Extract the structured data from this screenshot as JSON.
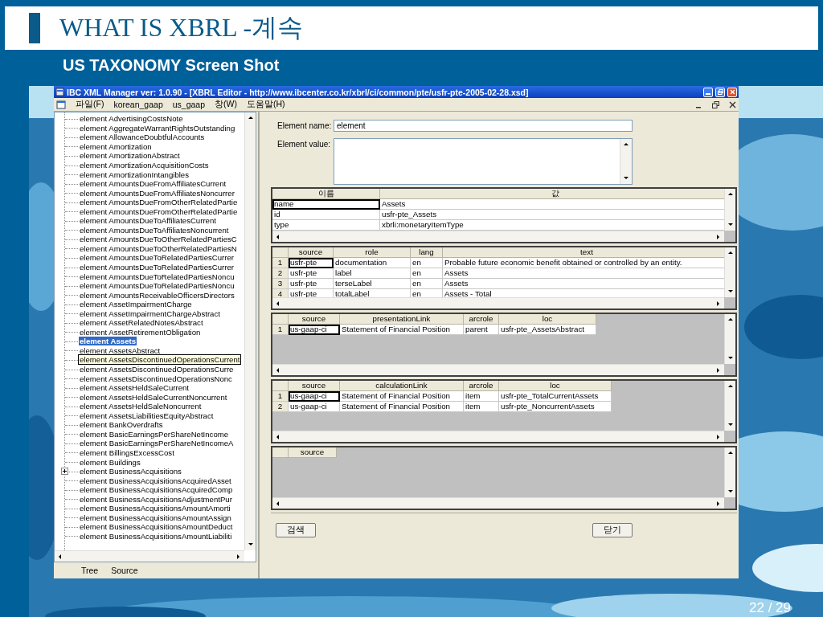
{
  "slide": {
    "title": "WHAT IS XBRL -계속",
    "subtitle": "US TAXONOMY Screen Shot",
    "page_number": "22 / 29"
  },
  "window": {
    "title": "IBC XML Manager ver: 1.0.90 - [XBRL Editor - http://www.ibcenter.co.kr/xbrl/ci/common/pte/usfr-pte-2005-02-28.xsd]"
  },
  "menu": [
    "파일(F)",
    "korean_gaap",
    "us_gaap",
    "창(W)",
    "도움말(H)"
  ],
  "tree": {
    "items": [
      {
        "label": "element AdvertisingCostsNote",
        "kind": "leaf",
        "selected": false,
        "hovered": false
      },
      {
        "label": "element AggregateWarrantRightsOutstanding",
        "kind": "leaf",
        "selected": false,
        "hovered": false
      },
      {
        "label": "element AllowanceDoubtfulAccounts",
        "kind": "leaf",
        "selected": false,
        "hovered": false
      },
      {
        "label": "element Amortization",
        "kind": "leaf",
        "selected": false,
        "hovered": false
      },
      {
        "label": "element AmortizationAbstract",
        "kind": "leaf",
        "selected": false,
        "hovered": false
      },
      {
        "label": "element AmortizationAcquisitionCosts",
        "kind": "leaf",
        "selected": false,
        "hovered": false
      },
      {
        "label": "element AmortizationIntangibles",
        "kind": "leaf",
        "selected": false,
        "hovered": false
      },
      {
        "label": "element AmountsDueFromAffiliatesCurrent",
        "kind": "leaf",
        "selected": false,
        "hovered": false
      },
      {
        "label": "element AmountsDueFromAffiliatesNoncurrer",
        "kind": "leaf",
        "selected": false,
        "hovered": false
      },
      {
        "label": "element AmountsDueFromOtherRelatedPartie",
        "kind": "leaf",
        "selected": false,
        "hovered": false
      },
      {
        "label": "element AmountsDueFromOtherRelatedPartie",
        "kind": "leaf",
        "selected": false,
        "hovered": false
      },
      {
        "label": "element AmountsDueToAffiliatesCurrent",
        "kind": "leaf",
        "selected": false,
        "hovered": false
      },
      {
        "label": "element AmountsDueToAffiliatesNoncurrent",
        "kind": "leaf",
        "selected": false,
        "hovered": false
      },
      {
        "label": "element AmountsDueToOtherRelatedPartiesC",
        "kind": "leaf",
        "selected": false,
        "hovered": false
      },
      {
        "label": "element AmountsDueToOtherRelatedPartiesN",
        "kind": "leaf",
        "selected": false,
        "hovered": false
      },
      {
        "label": "element AmountsDueToRelatedPartiesCurrer",
        "kind": "leaf",
        "selected": false,
        "hovered": false
      },
      {
        "label": "element AmountsDueToRelatedPartiesCurrer",
        "kind": "leaf",
        "selected": false,
        "hovered": false
      },
      {
        "label": "element AmountsDueToRelatedPartiesNoncu",
        "kind": "leaf",
        "selected": false,
        "hovered": false
      },
      {
        "label": "element AmountsDueToRelatedPartiesNoncu",
        "kind": "leaf",
        "selected": false,
        "hovered": false
      },
      {
        "label": "element AmountsReceivableOfficersDirectors",
        "kind": "leaf",
        "selected": false,
        "hovered": false
      },
      {
        "label": "element AssetImpairmentCharge",
        "kind": "leaf",
        "selected": false,
        "hovered": false
      },
      {
        "label": "element AssetImpairmentChargeAbstract",
        "kind": "leaf",
        "selected": false,
        "hovered": false
      },
      {
        "label": "element AssetRelatedNotesAbstract",
        "kind": "leaf",
        "selected": false,
        "hovered": false
      },
      {
        "label": "element AssetRetirementObligation",
        "kind": "leaf",
        "selected": false,
        "hovered": false
      },
      {
        "label": "element Assets",
        "kind": "leaf",
        "selected": true,
        "hovered": false
      },
      {
        "label": "element AssetsAbstract",
        "kind": "leaf",
        "selected": false,
        "hovered": false
      },
      {
        "label": "element AssetsDiscontinuedOperationsCurrent",
        "kind": "leaf",
        "selected": false,
        "hovered": true
      },
      {
        "label": "element AssetsDiscontinuedOperationsCurre",
        "kind": "leaf",
        "selected": false,
        "hovered": false
      },
      {
        "label": "element AssetsDiscontinuedOperationsNonc",
        "kind": "leaf",
        "selected": false,
        "hovered": false
      },
      {
        "label": "element AssetsHeldSaleCurrent",
        "kind": "leaf",
        "selected": false,
        "hovered": false
      },
      {
        "label": "element AssetsHeldSaleCurrentNoncurrent",
        "kind": "leaf",
        "selected": false,
        "hovered": false
      },
      {
        "label": "element AssetsHeldSaleNoncurrent",
        "kind": "leaf",
        "selected": false,
        "hovered": false
      },
      {
        "label": "element AssetsLiabilitiesEquityAbstract",
        "kind": "leaf",
        "selected": false,
        "hovered": false
      },
      {
        "label": "element BankOverdrafts",
        "kind": "leaf",
        "selected": false,
        "hovered": false
      },
      {
        "label": "element BasicEarningsPerShareNetIncome",
        "kind": "leaf",
        "selected": false,
        "hovered": false
      },
      {
        "label": "element BasicEarningsPerShareNetIncomeA",
        "kind": "leaf",
        "selected": false,
        "hovered": false
      },
      {
        "label": "element BillingsExcessCost",
        "kind": "leaf",
        "selected": false,
        "hovered": false
      },
      {
        "label": "element Buildings",
        "kind": "leaf",
        "selected": false,
        "hovered": false
      },
      {
        "label": "element BusinessAcquisitions",
        "kind": "group",
        "selected": false,
        "hovered": false
      },
      {
        "label": "element BusinessAcquisitionsAcquiredAsset",
        "kind": "leaf",
        "selected": false,
        "hovered": false
      },
      {
        "label": "element BusinessAcquisitionsAcquiredComp",
        "kind": "leaf",
        "selected": false,
        "hovered": false
      },
      {
        "label": "element BusinessAcquisitionsAdjustmentPur",
        "kind": "leaf",
        "selected": false,
        "hovered": false
      },
      {
        "label": "element BusinessAcquisitionsAmountAmorti",
        "kind": "leaf",
        "selected": false,
        "hovered": false
      },
      {
        "label": "element BusinessAcquisitionsAmountAssign",
        "kind": "leaf",
        "selected": false,
        "hovered": false
      },
      {
        "label": "element BusinessAcquisitionsAmountDeduct",
        "kind": "leaf",
        "selected": false,
        "hovered": false
      },
      {
        "label": "element BusinessAcquisitionsAmountLiabiliti",
        "kind": "leaf",
        "selected": false,
        "hovered": false
      }
    ]
  },
  "tabs": [
    {
      "label": "Tree"
    },
    {
      "label": "Source"
    }
  ],
  "form": {
    "name_label": "Element name:",
    "name_value": "element",
    "value_label": "Element value:"
  },
  "grids": [
    {
      "columns": [
        "이름",
        "값"
      ],
      "rows": [
        {
          "cells": [
            "name",
            "Assets"
          ],
          "focused": true
        },
        {
          "cells": [
            "id",
            "usfr-pte_Assets"
          ],
          "focused": false
        },
        {
          "cells": [
            "type",
            "xbrli:monetaryItemType"
          ],
          "focused": false
        }
      ]
    },
    {
      "columns": [
        "",
        "source",
        "role",
        "lang",
        "text"
      ],
      "rows": [
        {
          "cells": [
            "1",
            "usfr-pte",
            "documentation",
            "en",
            "Probable future economic benefit obtained or controlled by an entity."
          ],
          "focused": true
        },
        {
          "cells": [
            "2",
            "usfr-pte",
            "label",
            "en",
            "Assets"
          ],
          "focused": false
        },
        {
          "cells": [
            "3",
            "usfr-pte",
            "terseLabel",
            "en",
            "Assets"
          ],
          "focused": false
        },
        {
          "cells": [
            "4",
            "usfr-pte",
            "totalLabel",
            "en",
            "Assets - Total"
          ],
          "focused": false
        }
      ]
    },
    {
      "columns": [
        "",
        "source",
        "presentationLink",
        "arcrole",
        "loc"
      ],
      "rows": [
        {
          "cells": [
            "1",
            "us-gaap-ci",
            "Statement of Financial Position",
            "parent",
            "usfr-pte_AssetsAbstract"
          ],
          "focused": true
        }
      ]
    },
    {
      "columns": [
        "",
        "source",
        "calculationLink",
        "arcrole",
        "loc"
      ],
      "rows": [
        {
          "cells": [
            "1",
            "us-gaap-ci",
            "Statement of Financial Position",
            "item",
            "usfr-pte_TotalCurrentAssets"
          ],
          "focused": true
        },
        {
          "cells": [
            "2",
            "us-gaap-ci",
            "Statement of Financial Position",
            "item",
            "usfr-pte_NoncurrentAssets"
          ],
          "focused": false
        }
      ]
    },
    {
      "columns": [
        "",
        "source"
      ]
    }
  ],
  "buttons": [
    "검색",
    "닫기"
  ]
}
